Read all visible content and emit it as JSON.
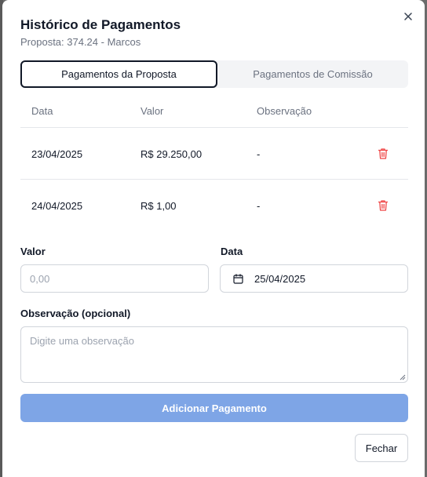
{
  "modal": {
    "title": "Histórico de Pagamentos",
    "subtitle": "Proposta: 374.24 - Marcos"
  },
  "tabs": [
    {
      "label": "Pagamentos da Proposta",
      "active": true
    },
    {
      "label": "Pagamentos de Comissão",
      "active": false
    }
  ],
  "table": {
    "headers": [
      "Data",
      "Valor",
      "Observação"
    ],
    "rows": [
      {
        "data": "23/04/2025",
        "valor": "R$ 29.250,00",
        "observacao": "-"
      },
      {
        "data": "24/04/2025",
        "valor": "R$ 1,00",
        "observacao": "-"
      }
    ]
  },
  "form": {
    "valor_label": "Valor",
    "valor_placeholder": "0,00",
    "data_label": "Data",
    "data_value": "25/04/2025",
    "observacao_label": "Observação (opcional)",
    "observacao_placeholder": "Digite uma observação"
  },
  "buttons": {
    "add": "Adicionar Pagamento",
    "close": "Fechar"
  },
  "colors": {
    "primary_disabled": "#7ea5e6",
    "danger": "#ef4444"
  },
  "icons": [
    "close-icon",
    "trash-icon",
    "calendar-icon"
  ]
}
